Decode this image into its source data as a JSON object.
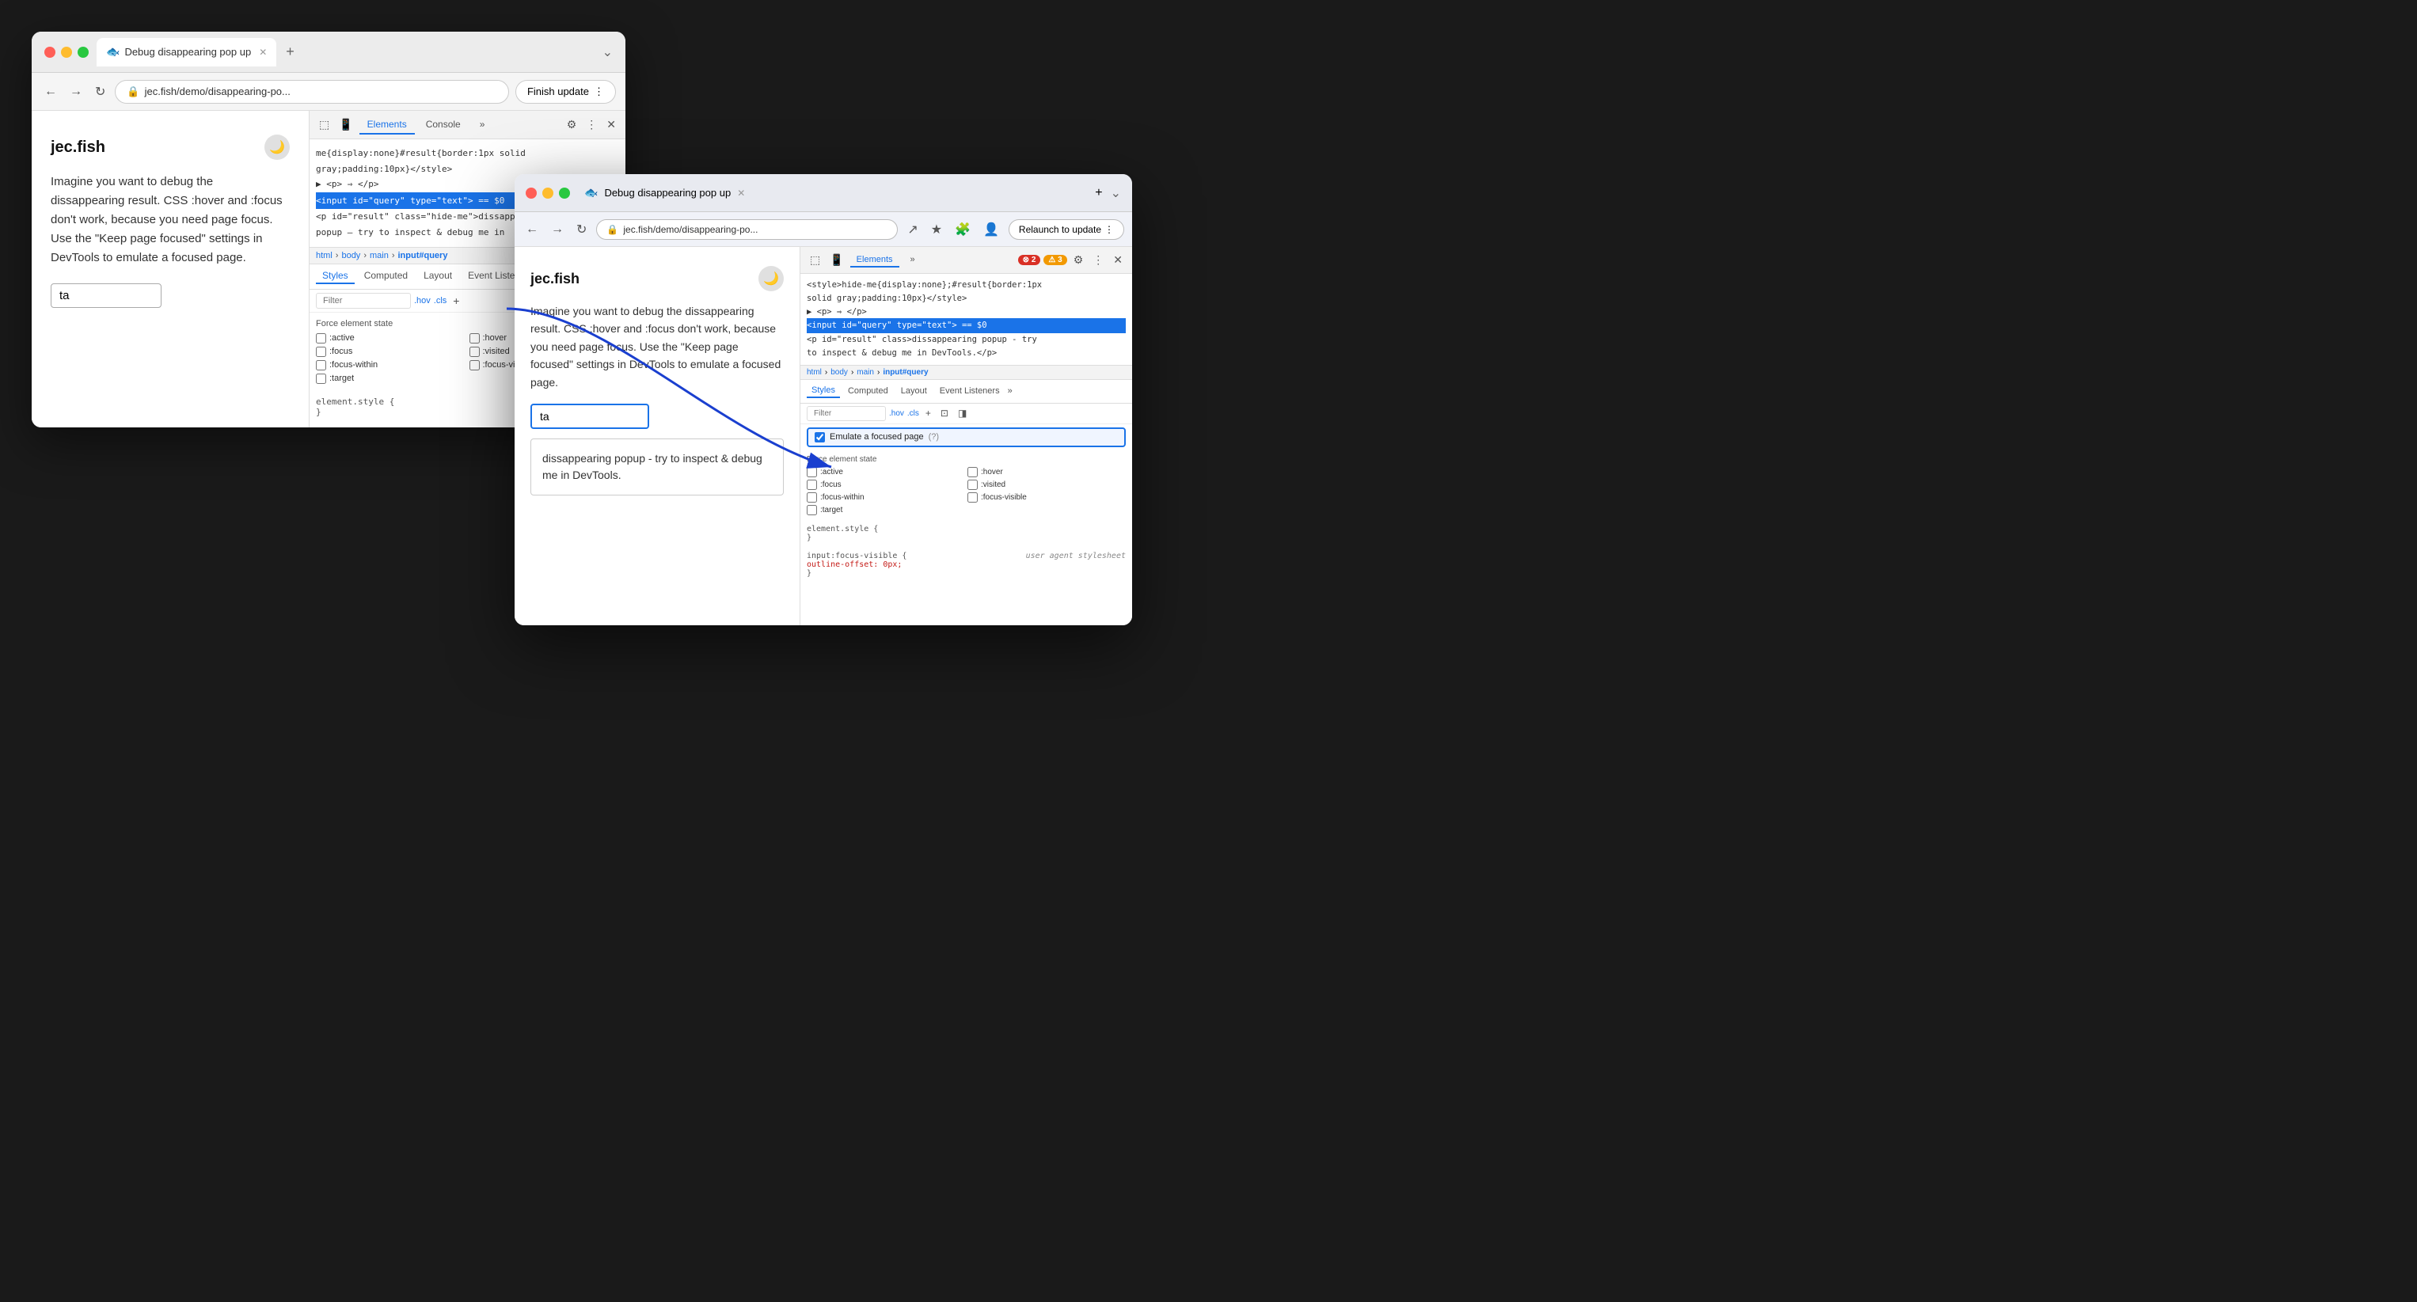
{
  "window1": {
    "title": "Debug disappearing pop up",
    "tab_label": "Debug disappearing pop up",
    "address": "jec.fish/demo/disappearing-po...",
    "finish_update": "Finish update",
    "site_title": "jec.fish",
    "description": "Imagine you want to debug the dissappearing result. CSS :hover and :focus don't work, because you need page focus. Use the \"Keep page focused\" settings in DevTools to emulate a focused page.",
    "input_value": "ta",
    "devtools": {
      "tabs": [
        "Elements",
        "Console"
      ],
      "more_label": "»",
      "breadcrumb": [
        "html",
        "body",
        "main",
        "input#query"
      ],
      "style_tabs": [
        "Styles",
        "Computed",
        "Layout",
        "Event Listeners"
      ],
      "filter_placeholder": "Filter",
      "hov": ".hov",
      "cls": ".cls",
      "code_lines": [
        "me{display:none}#result{border:1px solid",
        "gray;padding:10px}</style>",
        "<p> ⇒ </p>",
        "<input id=\"query\" type=\"text\"> == $0",
        "<p id=\"result\" class=\"hide-me\">dissapp",
        "popup – try to inspect & debug me in"
      ],
      "force_element_title": "Force element state",
      "checkboxes_left": [
        ":active",
        ":focus",
        ":focus-within",
        ":target"
      ],
      "checkboxes_right": [
        ":hover",
        ":visited",
        ":focus-visible"
      ],
      "element_style": "element.style {\n}"
    }
  },
  "window2": {
    "title": "Debug disappearing pop up",
    "address": "jec.fish/demo/disappearing-po...",
    "relaunch_update": "Relaunch to update",
    "site_title": "jec.fish",
    "description": "Imagine you want to debug the dissappearing result. CSS :hover and :focus don't work, because you need page focus. Use the \"Keep page focused\" settings in DevTools to emulate a focused page.",
    "input_value": "ta",
    "popup_text": "dissappearing popup - try to inspect & debug me in DevTools.",
    "devtools": {
      "tabs": [
        "Elements"
      ],
      "more_label": "»",
      "errors": "2",
      "warnings": "3",
      "breadcrumb": [
        "html",
        "body",
        "main",
        "input#query"
      ],
      "style_tabs": [
        "Styles",
        "Computed",
        "Layout",
        "Event Listeners"
      ],
      "filter_placeholder": "Filter",
      "hov": ".hov",
      "cls": ".cls",
      "emulate_focused_label": "Emulate a focused page",
      "code_lines": [
        "<style>hide-me{display:none};#result{border:1px",
        "solid gray;padding:10px}</style>",
        "<p> ⇒ </p>",
        "<input id=\"query\" type=\"text\"> == $0",
        "<p id=\"result\" class>dissappearing popup - try",
        "  to inspect & debug me in DevTools.</p>"
      ],
      "force_element_title": "Force element state",
      "checkboxes_left": [
        ":active",
        ":focus",
        ":focus-within",
        ":target"
      ],
      "checkboxes_right": [
        ":hover",
        ":visited",
        ":focus-visible"
      ],
      "element_style": "element.style {\n}",
      "user_agent_label": "user agent stylesheet",
      "css_rule": "input:focus-visible {",
      "css_prop": "  outline-offset: 0px;",
      "css_close": "}"
    }
  }
}
